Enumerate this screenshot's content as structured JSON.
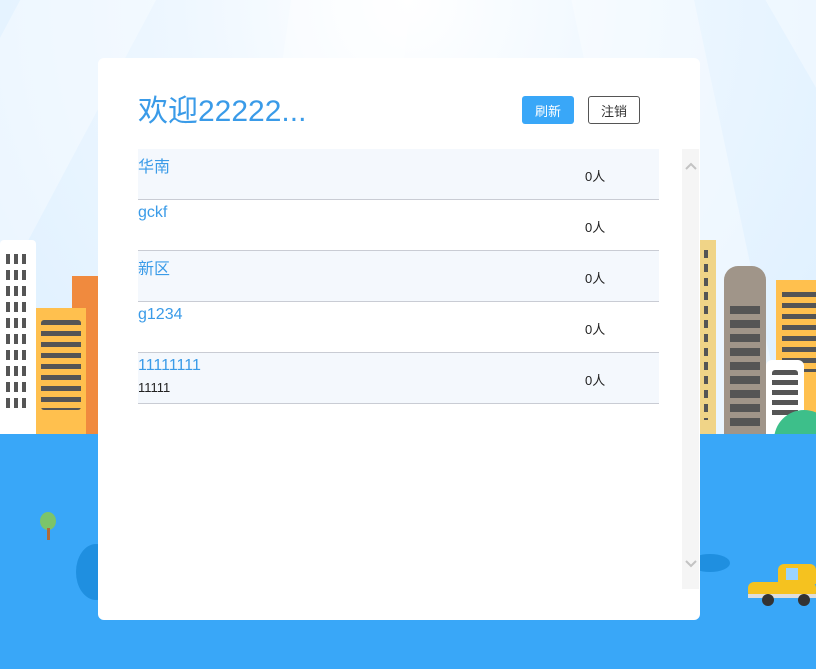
{
  "header": {
    "title": "欢迎22222...",
    "refresh_label": "刷新",
    "logout_label": "注销"
  },
  "rooms": [
    {
      "name": "华南",
      "sub": "",
      "count": "0人"
    },
    {
      "name": "gckf",
      "sub": "",
      "count": "0人"
    },
    {
      "name": "新区",
      "sub": "",
      "count": "0人"
    },
    {
      "name": "g1234",
      "sub": "",
      "count": "0人"
    },
    {
      "name": "11111111",
      "sub": "11111",
      "count": "0人"
    }
  ],
  "scrollbar": {
    "up_icon": "chevron-up-icon",
    "down_icon": "chevron-down-icon"
  },
  "colors": {
    "accent": "#39a7f8",
    "title": "#3a9be8",
    "ground": "#39a7f8"
  }
}
